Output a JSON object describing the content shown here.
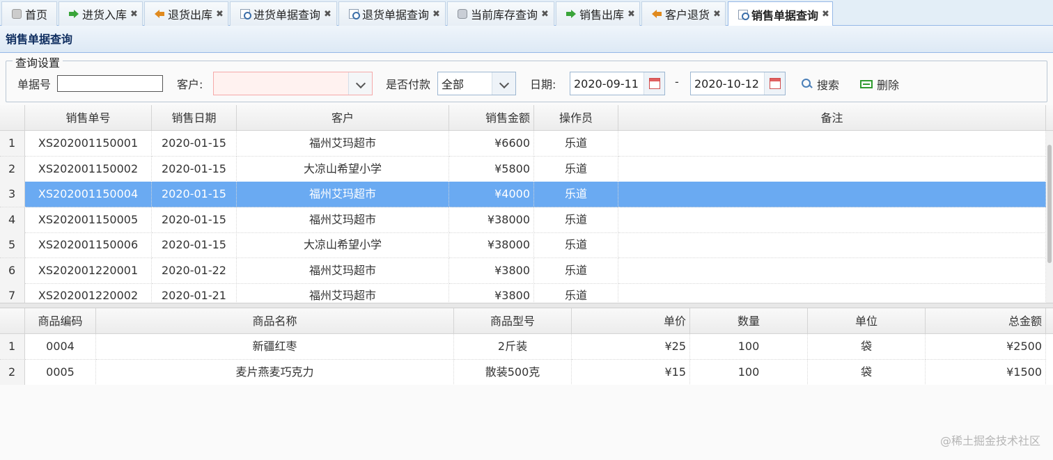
{
  "tabs": [
    {
      "label": "首页",
      "icon": "home-icon",
      "closable": false,
      "active": false
    },
    {
      "label": "进货入库",
      "icon": "stock-in-arrow-icon",
      "closable": true,
      "active": false
    },
    {
      "label": "退货出库",
      "icon": "return-out-arrow-icon",
      "closable": true,
      "active": false
    },
    {
      "label": "进货单据查询",
      "icon": "document-search-icon",
      "closable": true,
      "active": false
    },
    {
      "label": "退货单据查询",
      "icon": "document-search-icon",
      "closable": true,
      "active": false
    },
    {
      "label": "当前库存查询",
      "icon": "database-icon",
      "closable": true,
      "active": false
    },
    {
      "label": "销售出库",
      "icon": "stock-in-arrow-icon",
      "closable": true,
      "active": false
    },
    {
      "label": "客户退货",
      "icon": "return-out-arrow-icon",
      "closable": true,
      "active": false
    },
    {
      "label": "销售单据查询",
      "icon": "document-search-icon",
      "closable": true,
      "active": true
    }
  ],
  "close_glyph": "✖",
  "panel_title": "销售单据查询",
  "query": {
    "legend": "查询设置",
    "order_no_label": "单据号",
    "order_no_value": "",
    "customer_label": "客户:",
    "customer_value": "",
    "paid_label": "是否付款",
    "paid_value": "全部",
    "date_label": "日期:",
    "date_from": "2020-09-11",
    "date_sep": "-",
    "date_to": "2020-10-12",
    "search_label": "搜索",
    "delete_label": "删除"
  },
  "orders": {
    "columns": [
      "销售单号",
      "销售日期",
      "客户",
      "销售金额",
      "操作员",
      "备注"
    ],
    "selected_index": 2,
    "rows": [
      {
        "n": "1",
        "no": "XS202001150001",
        "date": "2020-01-15",
        "customer": "福州艾玛超市",
        "amount": "¥6600",
        "operator": "乐道",
        "remark": ""
      },
      {
        "n": "2",
        "no": "XS202001150002",
        "date": "2020-01-15",
        "customer": "大凉山希望小学",
        "amount": "¥5800",
        "operator": "乐道",
        "remark": ""
      },
      {
        "n": "3",
        "no": "XS202001150004",
        "date": "2020-01-15",
        "customer": "福州艾玛超市",
        "amount": "¥4000",
        "operator": "乐道",
        "remark": ""
      },
      {
        "n": "4",
        "no": "XS202001150005",
        "date": "2020-01-15",
        "customer": "福州艾玛超市",
        "amount": "¥38000",
        "operator": "乐道",
        "remark": ""
      },
      {
        "n": "5",
        "no": "XS202001150006",
        "date": "2020-01-15",
        "customer": "大凉山希望小学",
        "amount": "¥38000",
        "operator": "乐道",
        "remark": ""
      },
      {
        "n": "6",
        "no": "XS202001220001",
        "date": "2020-01-22",
        "customer": "福州艾玛超市",
        "amount": "¥3800",
        "operator": "乐道",
        "remark": ""
      },
      {
        "n": "7",
        "no": "XS202001220002",
        "date": "2020-01-21",
        "customer": "福州艾玛超市",
        "amount": "¥3800",
        "operator": "乐道",
        "remark": ""
      }
    ]
  },
  "items": {
    "columns": [
      "商品编码",
      "商品名称",
      "商品型号",
      "单价",
      "数量",
      "单位",
      "总金额"
    ],
    "rows": [
      {
        "n": "1",
        "code": "0004",
        "name": "新疆红枣",
        "model": "2斤装",
        "price": "¥25",
        "qty": "100",
        "unit": "袋",
        "total": "¥2500"
      },
      {
        "n": "2",
        "code": "0005",
        "name": "麦片燕麦巧克力",
        "model": "散装500克",
        "price": "¥15",
        "qty": "100",
        "unit": "袋",
        "total": "¥1500"
      }
    ]
  },
  "watermark": "@稀土掘金技术社区",
  "colors": {
    "selected_row": "#6aaaf2",
    "header_border": "#95b8e7"
  }
}
